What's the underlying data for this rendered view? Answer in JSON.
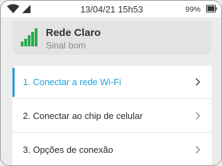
{
  "status_bar": {
    "time": "13/04/21 15h53",
    "battery_percent": "99%",
    "wifi_icon": "wifi-icon",
    "cell_icon": "cellular-signal-icon",
    "battery_icon": "battery-icon"
  },
  "network": {
    "name": "Rede Claro",
    "status": "Sinal bom",
    "icon": "signal-bars-icon",
    "color": "#27a84a"
  },
  "menu": {
    "accent_color": "#1a9fd6",
    "items": [
      {
        "label": "1. Conectar a rede Wi-Fi",
        "selected": true
      },
      {
        "label": "2. Conectar ao chip de celular",
        "selected": false
      },
      {
        "label": "3. Opções de conexão",
        "selected": false
      }
    ]
  }
}
